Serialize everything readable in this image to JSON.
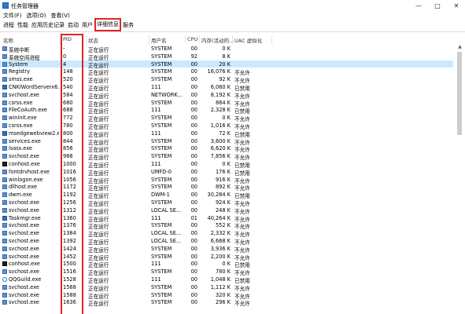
{
  "window": {
    "title": "任务管理器",
    "controls": [
      "—",
      "□",
      "✕"
    ]
  },
  "menu": [
    "文件(F)",
    "选项(O)",
    "查看(V)"
  ],
  "tabs": [
    {
      "label": "进程",
      "active": false
    },
    {
      "label": "性能",
      "active": false
    },
    {
      "label": "应用历史记录",
      "active": false
    },
    {
      "label": "启动",
      "active": false
    },
    {
      "label": "用户",
      "active": false
    },
    {
      "label": "详细信息",
      "active": true
    },
    {
      "label": "服务",
      "active": false
    }
  ],
  "columns": {
    "name": "名称",
    "pid": "PID",
    "status": "状态",
    "user": "用户名",
    "cpu": "CPU",
    "mem": "内存(活动的...",
    "uac": "UAC 虚拟化"
  },
  "rows": [
    {
      "icon": "system-process-icon",
      "name": "系统中断",
      "pid": "-",
      "status": "正在运行",
      "user": "SYSTEM",
      "cpu": "00",
      "mem": "0 K",
      "uac": ""
    },
    {
      "icon": "system-process-icon",
      "name": "系统空闲进程",
      "pid": "0",
      "status": "正在运行",
      "user": "SYSTEM",
      "cpu": "92",
      "mem": "8 K",
      "uac": ""
    },
    {
      "icon": "system-process-icon",
      "name": "System",
      "pid": "4",
      "status": "正在运行",
      "user": "SYSTEM",
      "cpu": "00",
      "mem": "20 K",
      "uac": "",
      "selected": true
    },
    {
      "icon": "system-process-icon",
      "name": "Registry",
      "pid": "148",
      "status": "正在运行",
      "user": "SYSTEM",
      "cpu": "00",
      "mem": "16,076 K",
      "uac": "不允许"
    },
    {
      "icon": "system-process-icon",
      "name": "smss.exe",
      "pid": "520",
      "status": "正在运行",
      "user": "SYSTEM",
      "cpu": "00",
      "mem": "92 K",
      "uac": "不允许"
    },
    {
      "icon": "app-process-icon",
      "name": "CNKIWordServerx6...",
      "pid": "540",
      "status": "正在运行",
      "user": "111",
      "cpu": "00",
      "mem": "6,060 K",
      "uac": "已禁用"
    },
    {
      "icon": "system-process-icon",
      "name": "svchost.exe",
      "pid": "584",
      "status": "正在运行",
      "user": "NETWORK...",
      "cpu": "00",
      "mem": "8,192 K",
      "uac": "不允许"
    },
    {
      "icon": "system-process-icon",
      "name": "csrss.exe",
      "pid": "680",
      "status": "正在运行",
      "user": "SYSTEM",
      "cpu": "00",
      "mem": "884 K",
      "uac": "不允许"
    },
    {
      "icon": "system-process-icon",
      "name": "FileCoAuth.exe",
      "pid": "688",
      "status": "正在运行",
      "user": "111",
      "cpu": "00",
      "mem": "2,328 K",
      "uac": "已禁用"
    },
    {
      "icon": "system-process-icon",
      "name": "wininit.exe",
      "pid": "772",
      "status": "正在运行",
      "user": "SYSTEM",
      "cpu": "00",
      "mem": "0 K",
      "uac": "不允许"
    },
    {
      "icon": "system-process-icon",
      "name": "csrss.exe",
      "pid": "780",
      "status": "正在运行",
      "user": "SYSTEM",
      "cpu": "00",
      "mem": "1,016 K",
      "uac": "不允许"
    },
    {
      "icon": "app-process-icon",
      "name": "msedgewebview2.e...",
      "pid": "800",
      "status": "正在运行",
      "user": "111",
      "cpu": "00",
      "mem": "72 K",
      "uac": "已禁用"
    },
    {
      "icon": "system-process-icon",
      "name": "services.exe",
      "pid": "844",
      "status": "正在运行",
      "user": "SYSTEM",
      "cpu": "00",
      "mem": "3,600 K",
      "uac": "不允许"
    },
    {
      "icon": "system-process-icon",
      "name": "lsass.exe",
      "pid": "856",
      "status": "正在运行",
      "user": "SYSTEM",
      "cpu": "00",
      "mem": "6,620 K",
      "uac": "不允许"
    },
    {
      "icon": "system-process-icon",
      "name": "svchost.exe",
      "pid": "988",
      "status": "正在运行",
      "user": "SYSTEM",
      "cpu": "00",
      "mem": "7,856 K",
      "uac": "不允许"
    },
    {
      "icon": "console-icon",
      "name": "conhost.exe",
      "pid": "1000",
      "status": "正在运行",
      "user": "111",
      "cpu": "00",
      "mem": "0 K",
      "uac": "已禁用"
    },
    {
      "icon": "system-process-icon",
      "name": "fontdrvhost.exe",
      "pid": "1016",
      "status": "正在运行",
      "user": "UMFD-0",
      "cpu": "00",
      "mem": "176 K",
      "uac": "已禁用"
    },
    {
      "icon": "system-process-icon",
      "name": "winlogon.exe",
      "pid": "1056",
      "status": "正在运行",
      "user": "SYSTEM",
      "cpu": "00",
      "mem": "916 K",
      "uac": "不允许"
    },
    {
      "icon": "system-process-icon",
      "name": "dllhost.exe",
      "pid": "1172",
      "status": "正在运行",
      "user": "SYSTEM",
      "cpu": "00",
      "mem": "892 K",
      "uac": "不允许"
    },
    {
      "icon": "system-process-icon",
      "name": "dwm.exe",
      "pid": "1192",
      "status": "正在运行",
      "user": "DWM-1",
      "cpu": "00",
      "mem": "30,284 K",
      "uac": "已禁用"
    },
    {
      "icon": "system-process-icon",
      "name": "svchost.exe",
      "pid": "1256",
      "status": "正在运行",
      "user": "SYSTEM",
      "cpu": "00",
      "mem": "924 K",
      "uac": "不允许"
    },
    {
      "icon": "system-process-icon",
      "name": "svchost.exe",
      "pid": "1312",
      "status": "正在运行",
      "user": "LOCAL SE...",
      "cpu": "00",
      "mem": "248 K",
      "uac": "不允许"
    },
    {
      "icon": "app-process-icon",
      "name": "Taskmgr.exe",
      "pid": "1360",
      "status": "正在运行",
      "user": "111",
      "cpu": "01",
      "mem": "40,264 K",
      "uac": "不允许"
    },
    {
      "icon": "system-process-icon",
      "name": "svchost.exe",
      "pid": "1376",
      "status": "正在运行",
      "user": "SYSTEM",
      "cpu": "00",
      "mem": "552 K",
      "uac": "不允许"
    },
    {
      "icon": "system-process-icon",
      "name": "svchost.exe",
      "pid": "1384",
      "status": "正在运行",
      "user": "LOCAL SE...",
      "cpu": "00",
      "mem": "2,332 K",
      "uac": "不允许"
    },
    {
      "icon": "system-process-icon",
      "name": "svchost.exe",
      "pid": "1392",
      "status": "正在运行",
      "user": "LOCAL SE...",
      "cpu": "00",
      "mem": "6,668 K",
      "uac": "不允许"
    },
    {
      "icon": "system-process-icon",
      "name": "svchost.exe",
      "pid": "1424",
      "status": "正在运行",
      "user": "SYSTEM",
      "cpu": "00",
      "mem": "3,936 K",
      "uac": "不允许"
    },
    {
      "icon": "system-process-icon",
      "name": "svchost.exe",
      "pid": "1452",
      "status": "正在运行",
      "user": "SYSTEM",
      "cpu": "00",
      "mem": "2,200 K",
      "uac": "不允许"
    },
    {
      "icon": "console-icon",
      "name": "conhost.exe",
      "pid": "1500",
      "status": "正在运行",
      "user": "111",
      "cpu": "00",
      "mem": "0 K",
      "uac": "已禁用"
    },
    {
      "icon": "system-process-icon",
      "name": "svchost.exe",
      "pid": "1516",
      "status": "正在运行",
      "user": "SYSTEM",
      "cpu": "00",
      "mem": "780 K",
      "uac": "不允许"
    },
    {
      "icon": "qq-icon",
      "name": "QQGuild.exe",
      "pid": "1528",
      "status": "正在运行",
      "user": "111",
      "cpu": "00",
      "mem": "1,048 K",
      "uac": "已禁用"
    },
    {
      "icon": "system-process-icon",
      "name": "svchost.exe",
      "pid": "1568",
      "status": "正在运行",
      "user": "SYSTEM",
      "cpu": "00",
      "mem": "1,112 K",
      "uac": "不允许"
    },
    {
      "icon": "system-process-icon",
      "name": "svchost.exe",
      "pid": "1588",
      "status": "正在运行",
      "user": "SYSTEM",
      "cpu": "00",
      "mem": "320 K",
      "uac": "不允许"
    },
    {
      "icon": "system-process-icon",
      "name": "svchost.exe",
      "pid": "1636",
      "status": "正在运行",
      "user": "SYSTEM",
      "cpu": "00",
      "mem": "296 K",
      "uac": "不允许"
    }
  ]
}
